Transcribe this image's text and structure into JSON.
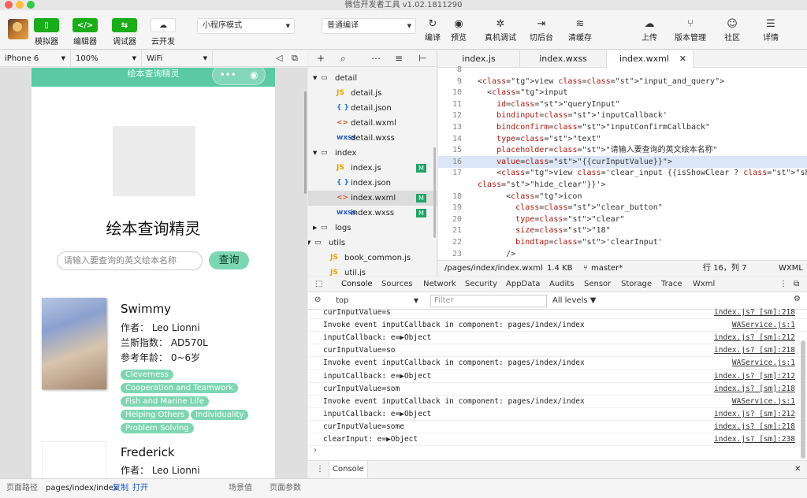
{
  "window": {
    "title": "微信开发者工具 v1.02.1811290"
  },
  "toolbar": {
    "simulator": "模拟器",
    "editor": "编辑器",
    "debugger": "调试器",
    "cloud": "云开发",
    "mode_select": "小程序模式",
    "compile_select": "普通编译",
    "compile": "编译",
    "preview": "预览",
    "remote_debug": "真机调试",
    "background": "切后台",
    "clear_cache": "清缓存",
    "upload": "上传",
    "version": "版本管理",
    "community": "社区",
    "details": "详情"
  },
  "simbar": {
    "device": "iPhone 6",
    "zoom": "100%",
    "network": "WiFi"
  },
  "phone": {
    "nav_title": "绘本查询精灵",
    "app_title": "绘本查询精灵",
    "search_placeholder": "请输入要查询的英文绘本名称",
    "query_button": "查询",
    "books": [
      {
        "title": "Swimmy",
        "author": "作者：  Leo Lionni",
        "lexile": "兰斯指数：  AD570L",
        "age": "参考年龄：  0~6岁",
        "tags": [
          "Cleverness",
          "Cooperation and Teamwork",
          "Fish and Marine Life",
          "Helping Others",
          "Individuality",
          "Problem Solving"
        ]
      },
      {
        "title": "Frederick",
        "author": "作者：  Leo Lionni"
      }
    ]
  },
  "statusbar": {
    "path_label": "页面路径",
    "path": "pages/index/index",
    "copy": "复制",
    "open": "打开",
    "scene": "场景值",
    "params": "页面参数"
  },
  "filetree": {
    "items": [
      {
        "name": "detail",
        "type": "folder"
      },
      {
        "name": "detail.js",
        "type": "js"
      },
      {
        "name": "detail.json",
        "type": "json"
      },
      {
        "name": "detail.wxml",
        "type": "wxml"
      },
      {
        "name": "detail.wxss",
        "type": "wxss"
      },
      {
        "name": "index",
        "type": "folder"
      },
      {
        "name": "index.js",
        "type": "js",
        "badge": "M"
      },
      {
        "name": "index.json",
        "type": "json"
      },
      {
        "name": "index.wxml",
        "type": "wxml",
        "badge": "M"
      },
      {
        "name": "index.wxss",
        "type": "wxss",
        "badge": "M"
      },
      {
        "name": "logs",
        "type": "folder"
      },
      {
        "name": "utils",
        "type": "folder"
      },
      {
        "name": "book_common.js",
        "type": "js"
      },
      {
        "name": "util.js",
        "type": "js"
      }
    ]
  },
  "editor": {
    "tabs": [
      "index.js",
      "index.wxss",
      "index.wxml"
    ],
    "lines": [
      {
        "n": "8",
        "t": ""
      },
      {
        "n": "9",
        "t": "<view class=\"input_and_query\">"
      },
      {
        "n": "10",
        "t": "  <input"
      },
      {
        "n": "11",
        "t": "    id=\"queryInput\""
      },
      {
        "n": "12",
        "t": "    bindinput='inputCallback'"
      },
      {
        "n": "13",
        "t": "    bindconfirm=\"inputConfirmCallback\""
      },
      {
        "n": "14",
        "t": "    type=\"text\""
      },
      {
        "n": "15",
        "t": "    placeholder=\"请输入要查询的英文绘本名称\""
      },
      {
        "n": "16",
        "t": "    value=\"{{curInputValue}}\">"
      },
      {
        "n": "17",
        "t": "    <view class='clear_input {{isShowClear ? \"show_clear\" :"
      },
      {
        "n": "",
        "t": "\"hide_clear\"}}'>"
      },
      {
        "n": "18",
        "t": "      <icon"
      },
      {
        "n": "19",
        "t": "        class=\"clear_button\""
      },
      {
        "n": "20",
        "t": "        type=\"clear\""
      },
      {
        "n": "21",
        "t": "        size=\"18\""
      },
      {
        "n": "22",
        "t": "        bindtap='clearInput'"
      },
      {
        "n": "23",
        "t": "      />"
      }
    ],
    "file_path": "/pages/index/index.wxml",
    "file_size": "1.4 KB",
    "branch": "master*",
    "cursor": "行 16，列 7",
    "language": "WXML"
  },
  "devtools": {
    "tabs": [
      "Console",
      "Sources",
      "Network",
      "Security",
      "AppData",
      "Audits",
      "Sensor",
      "Storage",
      "Trace",
      "Wxml"
    ],
    "context": "top",
    "filter_placeholder": "Filter",
    "levels": "All levels",
    "logs": [
      {
        "msg": "curInputValue=s",
        "src": "index.js? [sm]:218"
      },
      {
        "msg": "Invoke event inputCallback in component: pages/index/index",
        "src": "WAService.js:1"
      },
      {
        "msg": "inputCallback: e=▶Object",
        "src": "index.js? [sm]:212"
      },
      {
        "msg": "curInputValue=so",
        "src": "index.js? [sm]:218"
      },
      {
        "msg": "Invoke event inputCallback in component: pages/index/index",
        "src": "WAService.js:1"
      },
      {
        "msg": "inputCallback: e=▶Object",
        "src": "index.js? [sm]:212"
      },
      {
        "msg": "curInputValue=som",
        "src": "index.js? [sm]:218"
      },
      {
        "msg": "Invoke event inputCallback in component: pages/index/index",
        "src": "WAService.js:1"
      },
      {
        "msg": "inputCallback: e=▶Object",
        "src": "index.js? [sm]:212"
      },
      {
        "msg": "curInputValue=some",
        "src": "index.js? [sm]:218"
      },
      {
        "msg": "clearInput: e=▶Object",
        "src": "index.js? [sm]:238"
      }
    ],
    "drawer_tab": "Console"
  }
}
